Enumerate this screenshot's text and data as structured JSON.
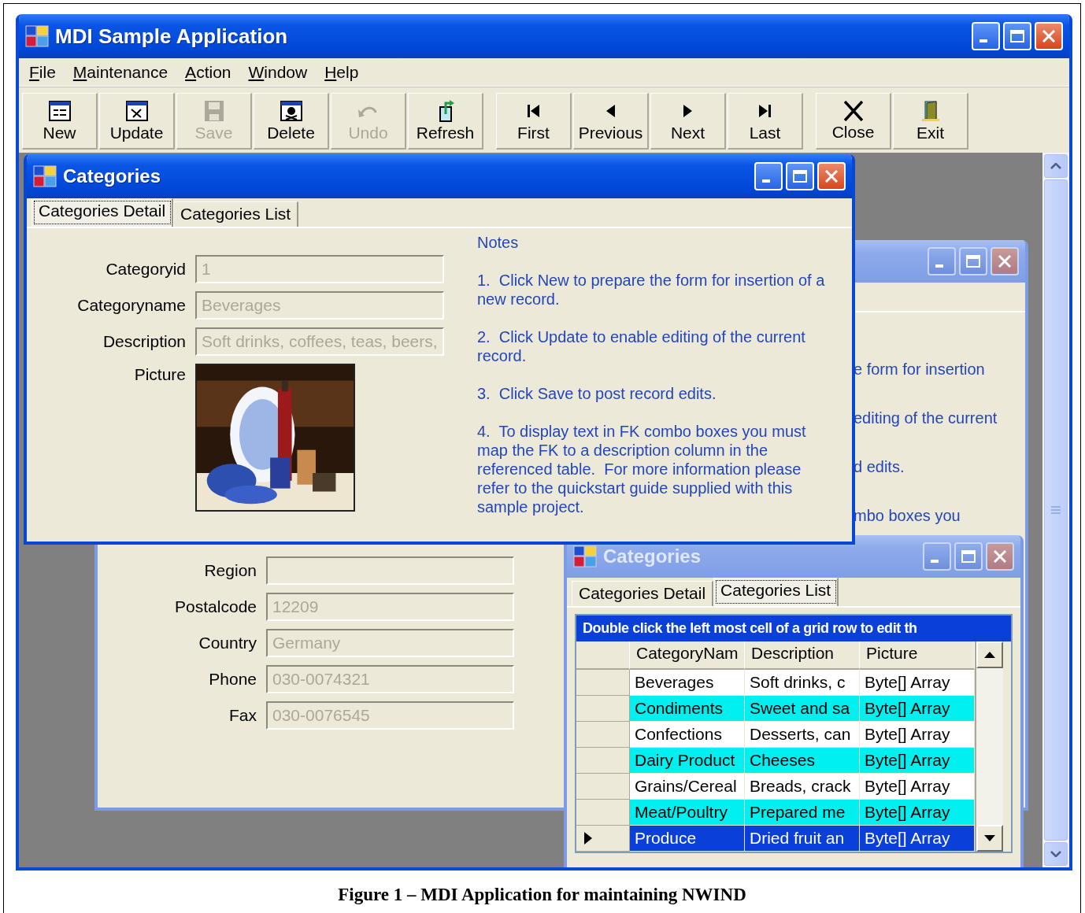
{
  "window": {
    "title": "MDI Sample Application"
  },
  "menu": [
    "File",
    "Maintenance",
    "Action",
    "Window",
    "Help"
  ],
  "toolbar": {
    "groups": [
      [
        {
          "kind": "new",
          "label": "New",
          "disabled": false
        },
        {
          "kind": "update",
          "label": "Update",
          "disabled": false
        },
        {
          "kind": "save",
          "label": "Save",
          "disabled": true
        },
        {
          "kind": "delete",
          "label": "Delete",
          "disabled": false
        },
        {
          "kind": "undo",
          "label": "Undo",
          "disabled": true
        },
        {
          "kind": "refresh",
          "label": "Refresh",
          "disabled": false
        }
      ],
      [
        {
          "kind": "first",
          "label": "First",
          "disabled": false
        },
        {
          "kind": "previous",
          "label": "Previous",
          "disabled": false
        },
        {
          "kind": "next",
          "label": "Next",
          "disabled": false
        },
        {
          "kind": "last",
          "label": "Last",
          "disabled": false
        }
      ],
      [
        {
          "kind": "close",
          "label": "Close",
          "disabled": false
        },
        {
          "kind": "exit",
          "label": "Exit",
          "disabled": false
        }
      ]
    ]
  },
  "back_window": {
    "active": false,
    "notes_fragments": [
      "e form for insertion",
      "editing of the current",
      "d edits.",
      "mbo boxes you"
    ],
    "fields": [
      {
        "label": "Region",
        "disabled": true
      },
      {
        "label": "Postalcode",
        "value": "12209",
        "disabled": true
      },
      {
        "label": "Country",
        "value": "Germany",
        "disabled": true
      },
      {
        "label": "Phone",
        "value": "030-0074321",
        "disabled": true
      },
      {
        "label": "Fax",
        "value": "030-0076545",
        "disabled": true
      }
    ]
  },
  "list_window": {
    "title": "Categories",
    "active": false,
    "tabs": [
      {
        "label": "Categories Detail",
        "selected": false
      },
      {
        "label": "Categories List",
        "selected": true
      }
    ],
    "grid": {
      "caption": "Double click the left most cell of a grid row to edit th",
      "columns": [
        "CategoryNam",
        "Description",
        "Picture"
      ],
      "rows": [
        {
          "cells": [
            "Beverages",
            "Soft drinks, c",
            "Byte[] Array"
          ],
          "selected": false,
          "current": false
        },
        {
          "cells": [
            "Condiments",
            "Sweet and sa",
            "Byte[] Array"
          ],
          "selected": false,
          "current": false
        },
        {
          "cells": [
            "Confections",
            "Desserts, can",
            "Byte[] Array"
          ],
          "selected": false,
          "current": false
        },
        {
          "cells": [
            "Dairy Product",
            "Cheeses",
            "Byte[] Array"
          ],
          "selected": false,
          "current": false
        },
        {
          "cells": [
            "Grains/Cereal",
            "Breads, crack",
            "Byte[] Array"
          ],
          "selected": false,
          "current": false
        },
        {
          "cells": [
            "Meat/Poultry",
            "Prepared me",
            "Byte[] Array"
          ],
          "selected": false,
          "current": false
        },
        {
          "cells": [
            "Produce",
            "Dried fruit an",
            "Byte[] Array"
          ],
          "selected": true,
          "current": true
        }
      ]
    }
  },
  "detail_window": {
    "title": "Categories",
    "active": true,
    "tabs": [
      {
        "label": "Categories Detail",
        "selected": true
      },
      {
        "label": "Categories List",
        "selected": false
      }
    ],
    "fields": [
      {
        "label": "Categoryid",
        "value": "1",
        "disabled": true
      },
      {
        "label": "Categoryname",
        "value": "Beverages",
        "disabled": true
      },
      {
        "label": "Description",
        "value": "Soft drinks, coffees, teas, beers,",
        "disabled": true
      }
    ],
    "picture_label": "Picture",
    "notes": {
      "heading": "Notes",
      "items": [
        "1.  Click New to prepare the form for insertion of a new record.",
        "2.  Click Update to enable editing of the current record.",
        "3.  Click Save to post record edits.",
        "4.  To display text in FK combo boxes you must map the FK to a description column in the referenced table.  For more information please refer to the quickstart guide supplied with this sample project."
      ]
    }
  },
  "figure_caption": "Figure 1 – MDI Application for maintaining NWIND"
}
